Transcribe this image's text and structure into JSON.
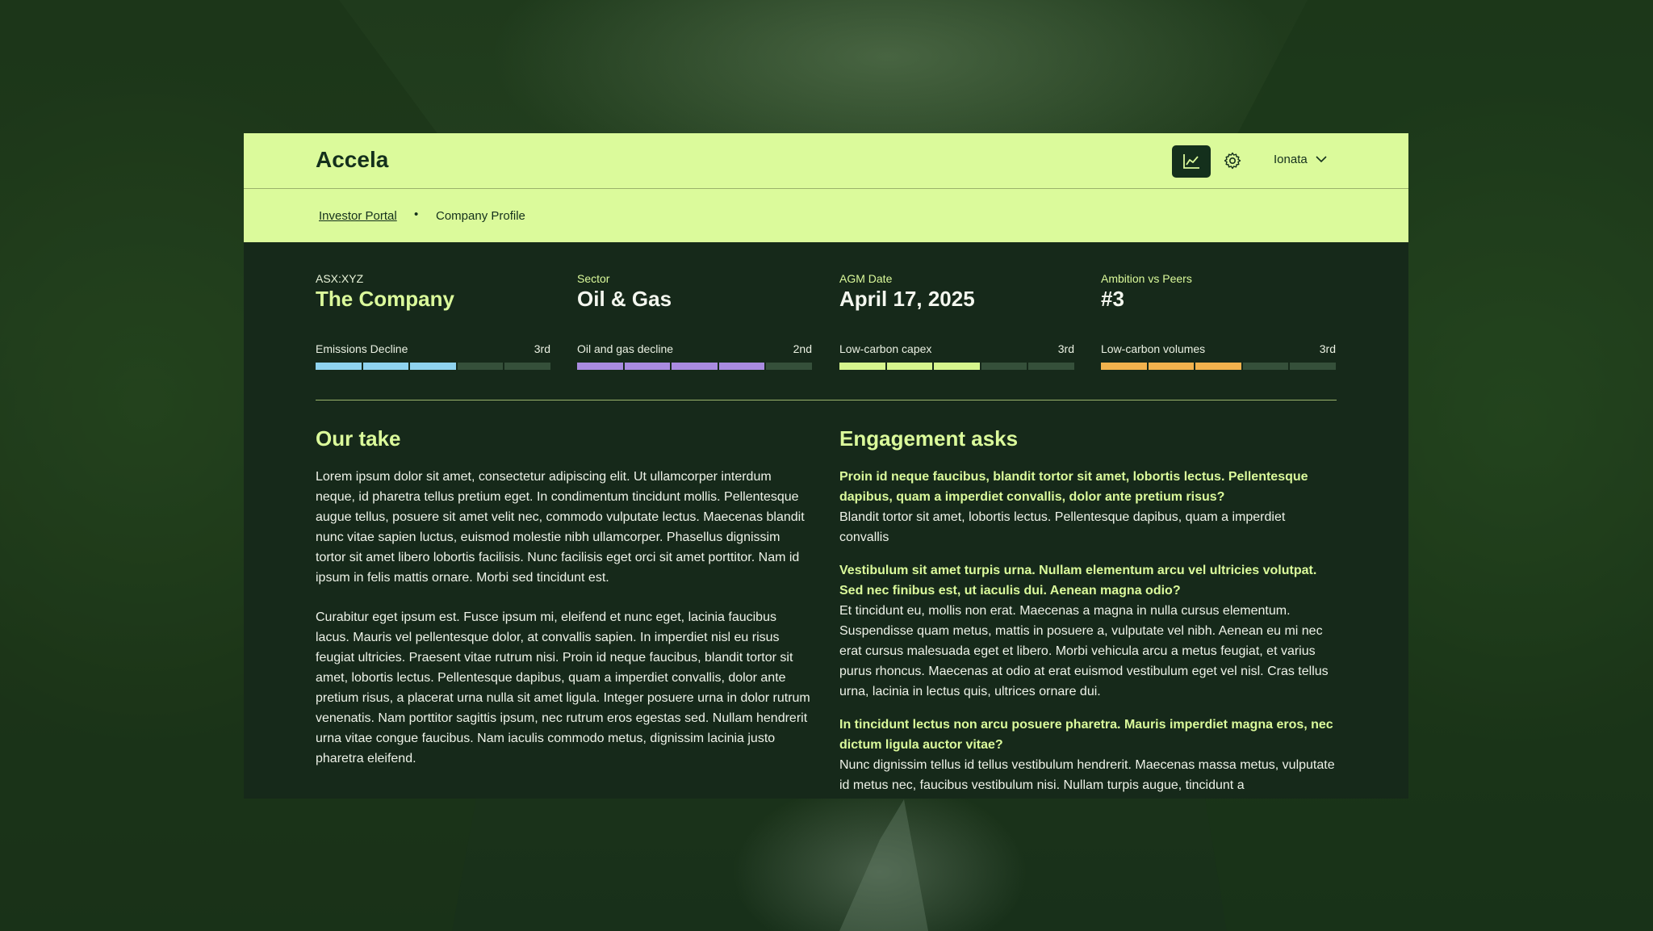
{
  "app": {
    "brand": "Accela"
  },
  "header": {
    "user_name": "Ionata"
  },
  "breadcrumb": {
    "items": [
      "Investor Portal",
      "Company Profile"
    ],
    "separator": "•"
  },
  "metrics": [
    {
      "label": "ASX:XYZ",
      "value": "The Company"
    },
    {
      "label": "Sector",
      "value": "Oil & Gas"
    },
    {
      "label": "AGM Date",
      "value": "April 17, 2025"
    },
    {
      "label": "Ambition vs Peers",
      "value": "#3"
    }
  ],
  "rankings": [
    {
      "label": "Emissions Decline",
      "rank": "3rd",
      "filled": 3,
      "total": 5,
      "color": "#8fd3ef"
    },
    {
      "label": "Oil and gas decline",
      "rank": "2nd",
      "filled": 4,
      "total": 5,
      "color": "#a98be0"
    },
    {
      "label": "Low-carbon capex",
      "rank": "3rd",
      "filled": 3,
      "total": 5,
      "color": "#d6f58d"
    },
    {
      "label": "Low-carbon volumes",
      "rank": "3rd",
      "filled": 3,
      "total": 5,
      "color": "#f2b24d"
    }
  ],
  "our_take": {
    "title": "Our take",
    "paragraphs": [
      "Lorem ipsum dolor sit amet, consectetur adipiscing elit. Ut ullamcorper interdum neque, id pharetra tellus pretium eget. In condimentum tincidunt mollis. Pellentesque augue tellus, posuere sit amet velit nec, commodo vulputate lectus. Maecenas blandit nunc vitae sapien luctus, euismod molestie nibh ullamcorper. Phasellus dignissim tortor sit amet libero lobortis facilisis. Nunc facilisis eget orci sit amet porttitor. Nam id ipsum in felis mattis ornare. Morbi sed tincidunt est.",
      "Curabitur eget ipsum est. Fusce ipsum mi, eleifend et nunc eget, lacinia faucibus lacus. Mauris vel pellentesque dolor, at convallis sapien. In imperdiet nisl eu risus feugiat ultricies. Praesent vitae rutrum nisi. Proin id neque faucibus, blandit tortor sit amet, lobortis lectus. Pellentesque dapibus, quam a imperdiet convallis, dolor ante pretium risus, a placerat urna nulla sit amet ligula. Integer posuere urna in dolor rutrum venenatis. Nam porttitor sagittis ipsum, nec rutrum eros egestas sed. Nullam hendrerit urna vitae congue faucibus. Nam iaculis commodo metus, dignissim lacinia justo pharetra eleifend."
    ]
  },
  "engagement": {
    "title": "Engagement asks",
    "asks": [
      {
        "question": "Proin id neque faucibus, blandit tortor sit amet, lobortis lectus. Pellentesque dapibus, quam a imperdiet convallis, dolor ante pretium risus?",
        "answer": "Blandit tortor sit amet, lobortis lectus. Pellentesque dapibus, quam a imperdiet convallis"
      },
      {
        "question": "Vestibulum sit amet turpis urna. Nullam elementum arcu vel ultricies volutpat. Sed nec finibus est, ut iaculis dui. Aenean magna odio?",
        "answer": "Et tincidunt eu, mollis non erat. Maecenas a magna in nulla cursus elementum. Suspendisse quam metus, mattis in posuere a, vulputate vel nibh. Aenean eu mi nec erat cursus malesuada eget et libero. Morbi vehicula arcu a metus feugiat, et varius purus rhoncus. Maecenas at odio at erat euismod vestibulum eget vel nisl. Cras tellus urna, lacinia in lectus quis, ultrices ornare dui."
      },
      {
        "question": "In tincidunt lectus non arcu posuere pharetra. Mauris imperdiet magna eros, nec dictum ligula auctor vitae?",
        "answer": "Nunc dignissim tellus id tellus vestibulum hendrerit. Maecenas massa metus, vulputate id metus nec, faucibus vestibulum nisi. Nullam turpis augue, tincidunt a"
      }
    ]
  },
  "icons": {
    "chart": "line-chart-icon",
    "settings": "gear-icon",
    "dropdown": "chevron-down-icon"
  },
  "colors": {
    "accent": "#dbfa9b",
    "panel": "#16291a",
    "dark_text": "#14301c"
  }
}
